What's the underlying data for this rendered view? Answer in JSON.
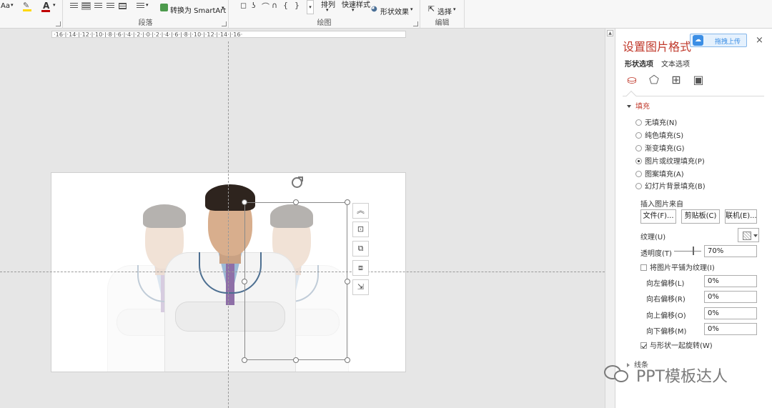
{
  "ribbon": {
    "font_case_label": "Aa",
    "highlight_icon": "highlighter-icon",
    "font_color_label": "A",
    "font_color": "#c00000",
    "smartart_label": "转换为 SmartArt",
    "arrange_label": "排列",
    "quick_styles_label": "快速样式",
    "shape_effects_label": "形状效果",
    "select_label": "选择",
    "groups": {
      "paragraph": "段落",
      "drawing": "绘图",
      "editing": "编辑"
    }
  },
  "ruler": {
    "text": "·16·|·14·|·12·|·10·|·8·|·6·|·4·|·2·|·0·|·2·|·4·|·6·|·8·|·10·|·12·|·14·|·16·"
  },
  "pane": {
    "title": "设置图片格式",
    "upload_label": "拖拽上传",
    "close_label": "×",
    "tabs": [
      {
        "label": "形状选项",
        "active": true
      },
      {
        "label": "文本选项",
        "active": false
      }
    ],
    "category_icons": [
      "fill-line-icon",
      "effects-pentagon-icon",
      "size-properties-icon",
      "picture-icon"
    ],
    "fill_section": "填充",
    "fill_options": [
      {
        "label": "无填充(N)",
        "selected": false
      },
      {
        "label": "纯色填充(S)",
        "selected": false
      },
      {
        "label": "渐变填充(G)",
        "selected": false
      },
      {
        "label": "图片或纹理填充(P)",
        "selected": true
      },
      {
        "label": "图案填充(A)",
        "selected": false
      },
      {
        "label": "幻灯片背景填充(B)",
        "selected": false
      }
    ],
    "insert_from_label": "插入图片来自",
    "buttons": {
      "file": "文件(F)...",
      "clipboard": "剪贴板(C)",
      "online": "联机(E)..."
    },
    "texture_label": "纹理(U)",
    "transparency_label": "透明度(T)",
    "transparency_value": "70%",
    "transparency_fraction": 0.7,
    "tile_label": "将图片平铺为纹理(I)",
    "tile_checked": false,
    "offsets": [
      {
        "label": "向左偏移(L)",
        "value": "0%"
      },
      {
        "label": "向右偏移(R)",
        "value": "0%"
      },
      {
        "label": "向上偏移(O)",
        "value": "0%"
      },
      {
        "label": "向下偏移(M)",
        "value": "0%"
      }
    ],
    "rotate_label": "与形状一起旋转(W)",
    "rotate_checked": true,
    "line_section": "线条"
  },
  "watermark": {
    "text": "PPT模板达人"
  },
  "colors": {
    "accent": "#c0392b",
    "upload_blue": "#3b8ee5"
  }
}
